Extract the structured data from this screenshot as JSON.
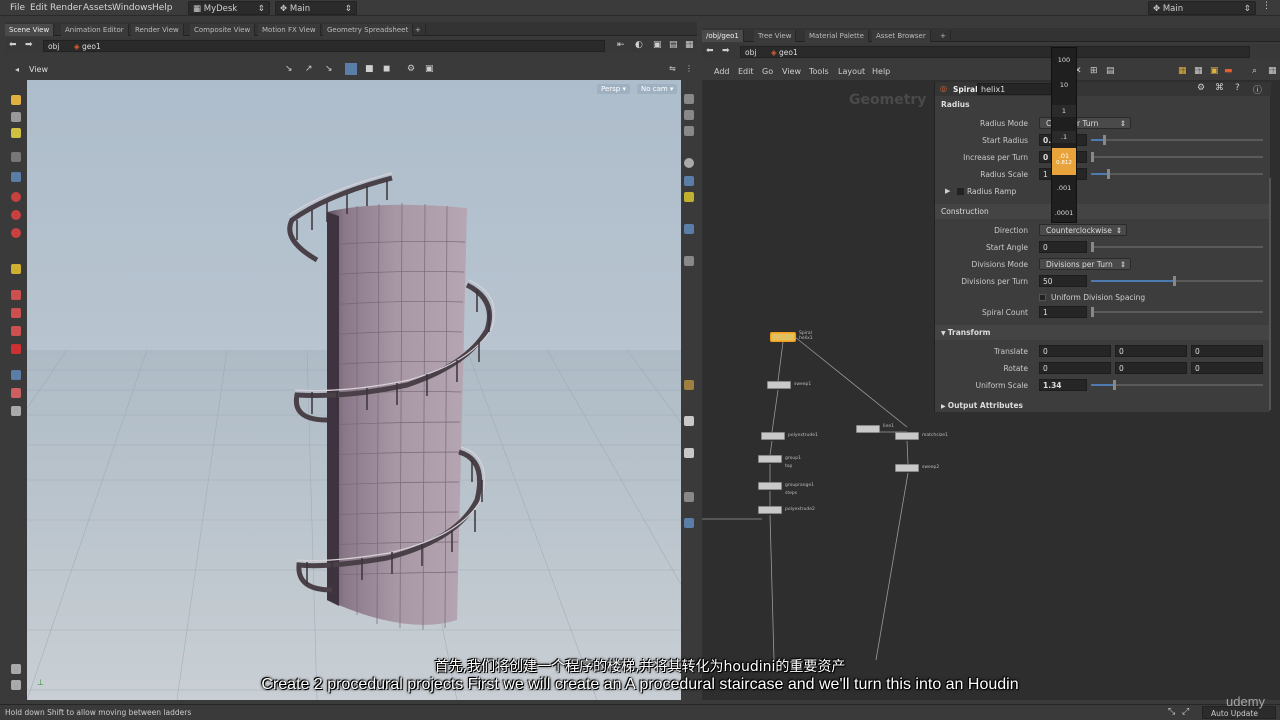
{
  "menu": [
    "File",
    "Edit",
    "Render",
    "Assets",
    "Windows",
    "Help"
  ],
  "desktop": "MyDesk",
  "main_left": "Main",
  "main_right": "Main",
  "left_tabs": [
    "Scene View",
    "Animation Editor",
    "Render View",
    "Composite View",
    "Motion FX View",
    "Geometry Spreadsheet"
  ],
  "right_tabs": [
    "/obj/geo1",
    "Tree View",
    "Material Palette",
    "Asset Browser"
  ],
  "path_left": {
    "obj": "obj",
    "geo": "geo1"
  },
  "path_right": {
    "obj": "obj",
    "geo": "geo1"
  },
  "viewport": {
    "title": "View",
    "persp": "Persp",
    "cam": "No cam"
  },
  "network_menu": [
    "Add",
    "Edit",
    "Go",
    "View",
    "Tools",
    "Layout",
    "Help"
  ],
  "network_label": "Geometry",
  "param_header": {
    "type": "Spiral",
    "name": "helix1"
  },
  "params": {
    "radius_section": "Radius",
    "radius_mode_label": "Radius Mode",
    "radius_mode_value": "Co... ...er Turn",
    "start_radius_label": "Start Radius",
    "start_radius_value": "0.",
    "increase_label": "Increase per Turn",
    "increase_value": "0",
    "radius_scale_label": "Radius Scale",
    "radius_scale_value": "1",
    "radius_ramp_label": "Radius Ramp",
    "construction_section": "Construction",
    "direction_label": "Direction",
    "direction_value": "Counterclockwise",
    "start_angle_label": "Start Angle",
    "start_angle_value": "0",
    "divisions_mode_label": "Divisions Mode",
    "divisions_mode_value": "Divisions per Turn",
    "divisions_per_turn_label": "Divisions per Turn",
    "divisions_per_turn_value": "50",
    "uniform_division_label": "Uniform Division Spacing",
    "spiral_count_label": "Spiral Count",
    "spiral_count_value": "1",
    "transform_section": "Transform",
    "translate_label": "Translate",
    "translate_values": [
      "0",
      "0",
      "0"
    ],
    "rotate_label": "Rotate",
    "rotate_values": [
      "0",
      "0",
      "0"
    ],
    "uniform_scale_label": "Uniform Scale",
    "uniform_scale_value": "1.34",
    "output_section": "Output Attributes"
  },
  "value_popup": [
    "100",
    "10",
    "1",
    ".1",
    ".01",
    "0.812",
    ".001",
    ".0001"
  ],
  "nodes": {
    "helix1": "helix1",
    "sweep1": "sweep1",
    "polyextrude1": "polyextrude1",
    "group1": "group1",
    "grouprange1": "grouprange1",
    "polyextrude2": "polyextrude2",
    "line1": "line1",
    "matchsize1": "matchsize1",
    "sweep2": "sweep2",
    "spiral_tag": "Spiral",
    "top_tag": "top",
    "steps_tag": "steps"
  },
  "subtitle_cn": "首先,我们将创建一个程序的楼梯,并将其转化为houdini的重要资产",
  "subtitle_en": "Create 2 procedural projects  First  we will create an A procedural staircase and we'll turn this into an Houdin",
  "status_text": "Hold down Shift to allow moving between ladders",
  "auto_update": "Auto Update",
  "watermark": "udemy",
  "colors": {
    "accent": "#e8a43a",
    "selection": "#4d7ab0"
  }
}
